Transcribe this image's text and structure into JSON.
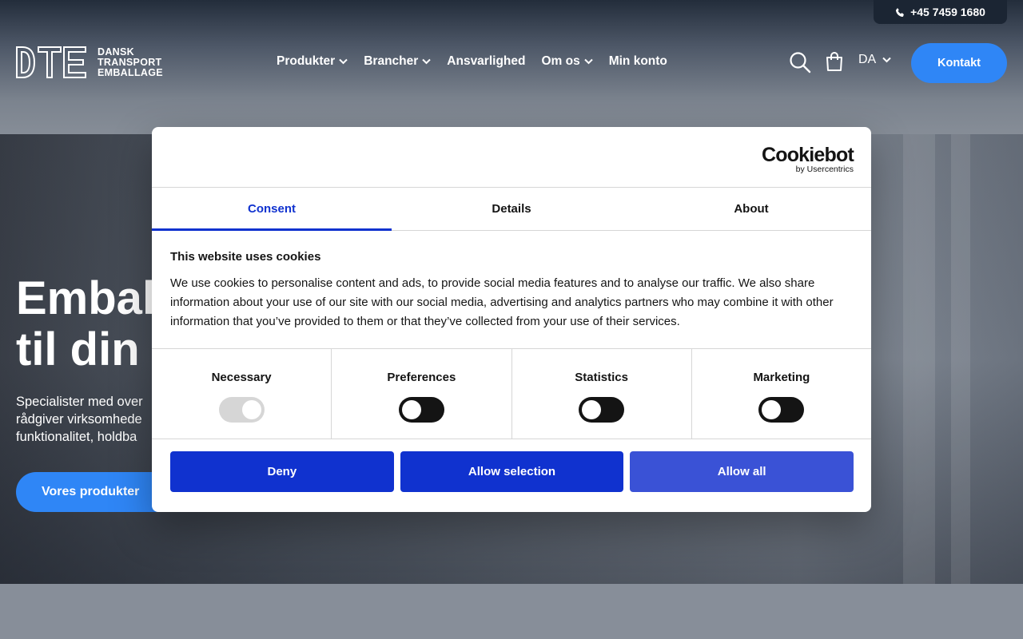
{
  "header": {
    "phone": "+45 7459 1680",
    "logo_initials": "DTE",
    "logo_lines": [
      "DANSK",
      "TRANSPORT",
      "EMBALLAGE"
    ],
    "nav": [
      {
        "label": "Produkter",
        "dropdown": true
      },
      {
        "label": "Brancher",
        "dropdown": true
      },
      {
        "label": "Ansvarlighed",
        "dropdown": false
      },
      {
        "label": "Om os",
        "dropdown": true
      },
      {
        "label": "Min konto",
        "dropdown": false
      }
    ],
    "language": "DA",
    "contact_button": "Kontakt",
    "icons": [
      "phone-icon",
      "search-icon",
      "shopping-bag-icon",
      "chevron-down-icon"
    ]
  },
  "hero": {
    "title_line1": "Embal",
    "title_line2": "til din",
    "text_line1": "Specialister med over",
    "text_line2": "rådgiver virksomhede",
    "text_line3": "funktionalitet, holdba",
    "cta": "Vores produkter"
  },
  "cookie_dialog": {
    "brand": "Cookiebot",
    "brand_sub": "by Usercentrics",
    "tabs": [
      {
        "label": "Consent",
        "active": true
      },
      {
        "label": "Details",
        "active": false
      },
      {
        "label": "About",
        "active": false
      }
    ],
    "heading": "This website uses cookies",
    "body": "We use cookies to personalise content and ads, to provide social media features and to analyse our traffic. We also share information about your use of our site with our social media, advertising and analytics partners who may combine it with other information that you’ve provided to them or that they’ve collected from your use of their services.",
    "categories": [
      {
        "label": "Necessary",
        "checked": true,
        "disabled": true
      },
      {
        "label": "Preferences",
        "checked": false,
        "disabled": false
      },
      {
        "label": "Statistics",
        "checked": false,
        "disabled": false
      },
      {
        "label": "Marketing",
        "checked": false,
        "disabled": false
      }
    ],
    "buttons": {
      "deny": "Deny",
      "allow_selection": "Allow selection",
      "allow_all": "Allow all"
    },
    "colors": {
      "accent": "#1032cf",
      "toggle_off": "#141414",
      "toggle_disabled": "#d6d6d6"
    }
  },
  "colors": {
    "brand_blue": "#2f86f6",
    "header_dark": "#1b2533"
  }
}
